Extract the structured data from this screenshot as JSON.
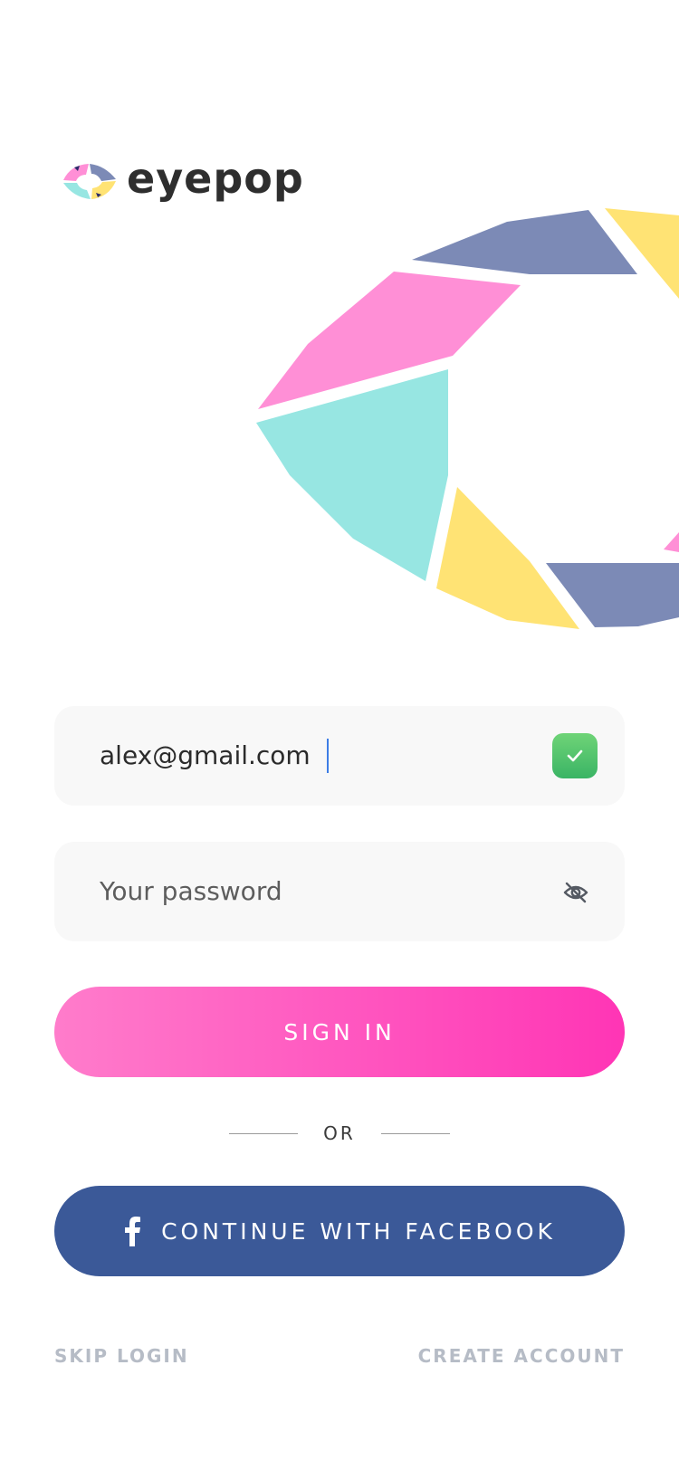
{
  "brand": {
    "name": "eyepop",
    "colors": {
      "pink": "#ff8fd6",
      "teal": "#97e6e2",
      "yellow": "#ffe374",
      "slate": "#7c8ab6"
    }
  },
  "form": {
    "email": {
      "value": "alex@gmail.com",
      "valid": true,
      "status_icon": "check-icon"
    },
    "password": {
      "placeholder": "Your password",
      "toggle_icon": "eye-off-icon"
    }
  },
  "actions": {
    "sign_in_label": "SIGN IN",
    "divider_label": "OR",
    "facebook_label": "CONTINUE WITH FACEBOOK",
    "facebook_icon": "facebook-icon",
    "skip_label": "SKIP LOGIN",
    "create_label": "CREATE ACCOUNT"
  },
  "colors": {
    "sign_in_gradient_start": "#ff7ccb",
    "sign_in_gradient_end": "#ff35b5",
    "facebook_blue": "#3b5998",
    "valid_green": "#47bd6a",
    "caret_blue": "#3d7de6",
    "field_bg": "#f8f8f8",
    "link_gray": "#b6bcc6"
  }
}
